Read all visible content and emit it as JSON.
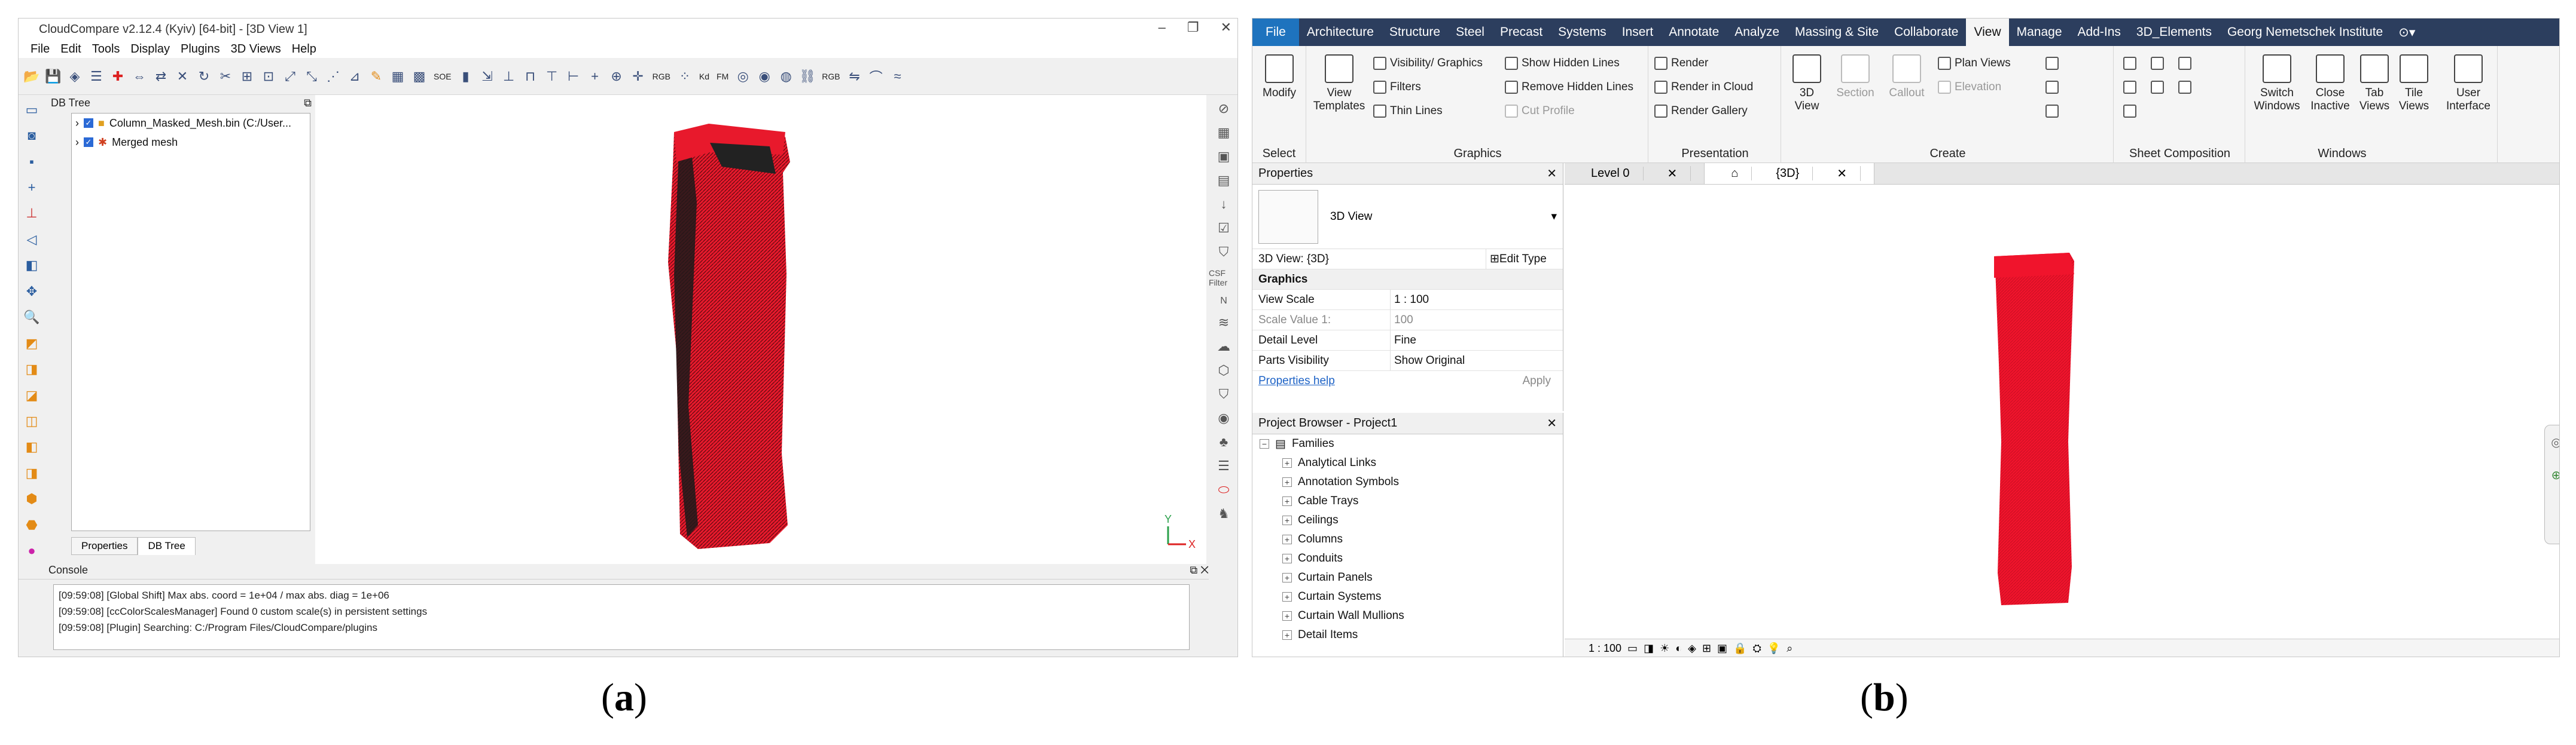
{
  "captions": {
    "a": "a",
    "b": "b"
  },
  "cloudcompare": {
    "title": "CloudCompare v2.12.4 (Kyiv) [64-bit] - [3D View 1]",
    "menu": [
      "File",
      "Edit",
      "Tools",
      "Display",
      "Plugins",
      "3D Views",
      "Help"
    ],
    "toolbar_texts": [
      "SOE",
      "Kd",
      "FM",
      "RGB",
      "RGB"
    ],
    "db_tree_title": "DB Tree",
    "tree_items": [
      "Column_Masked_Mesh.bin (C:/User...",
      "Merged mesh"
    ],
    "tabs": [
      "Properties",
      "DB Tree"
    ],
    "console_title": "Console",
    "console_lines": [
      "[09:59:08] [Global Shift] Max abs. coord = 1e+04 / max abs. diag = 1e+06",
      "[09:59:08] [ccColorScalesManager] Found 0 custom scale(s) in persistent settings",
      "[09:59:08] [Plugin] Searching: C:/Program Files/CloudCompare/plugins"
    ],
    "right_texts": [
      "CSF Filter",
      "N"
    ],
    "axis": {
      "y": "Y",
      "x": "X"
    },
    "colors": {
      "mesh": "#e8192c",
      "dark": "#1a1a1a"
    }
  },
  "revit": {
    "tabs": [
      "File",
      "Architecture",
      "Structure",
      "Steel",
      "Precast",
      "Systems",
      "Insert",
      "Annotate",
      "Analyze",
      "Massing & Site",
      "Collaborate",
      "View",
      "Manage",
      "Add-Ins",
      "3D_Elements",
      "Georg Nemetschek Institute"
    ],
    "active_tab": "View",
    "ribbon": {
      "select": {
        "modify": "Modify",
        "label": "Select"
      },
      "graphics": {
        "templates": "View Templates",
        "vis": "Visibility/ Graphics",
        "filters": "Filters",
        "thin": "Thin Lines",
        "show_hidden": "Show Hidden Lines",
        "remove_hidden": "Remove Hidden Lines",
        "cut": "Cut Profile",
        "label": "Graphics"
      },
      "presentation": {
        "render": "Render",
        "render_cloud": "Render in Cloud",
        "gallery": "Render Gallery",
        "label": "Presentation"
      },
      "create": {
        "view3d": "3D View",
        "section": "Section",
        "callout": "Callout",
        "plan": "Plan Views",
        "elevation": "Elevation",
        "label": "Create"
      },
      "sheet": {
        "label": "Sheet Composition"
      },
      "windows": {
        "switch": "Switch Windows",
        "close": "Close Inactive",
        "tab": "Tab Views",
        "tile": "Tile Views",
        "ui": "User Interface",
        "label": "Windows"
      }
    },
    "properties": {
      "title": "Properties",
      "type": "3D View",
      "selector": "3D View: {3D}",
      "edit_type": "Edit Type",
      "section": "Graphics",
      "rows": [
        {
          "k": "View Scale",
          "v": "1 : 100"
        },
        {
          "k": "Scale Value    1:",
          "v": "100"
        },
        {
          "k": "Detail Level",
          "v": "Fine"
        },
        {
          "k": "Parts Visibility",
          "v": "Show Original"
        }
      ],
      "help": "Properties help",
      "apply": "Apply"
    },
    "browser": {
      "title": "Project Browser - Project1",
      "root": "Families",
      "items": [
        "Analytical Links",
        "Annotation Symbols",
        "Cable Trays",
        "Ceilings",
        "Columns",
        "Conduits",
        "Curtain Panels",
        "Curtain Systems",
        "Curtain Wall Mullions",
        "Detail Items"
      ]
    },
    "view_tabs": [
      "Level 0",
      "{3D}"
    ],
    "status_scale": "1 : 100",
    "colors": {
      "mesh": "#f0142c",
      "title_bar": "#2c3e5e",
      "file_tab": "#1e73be"
    }
  }
}
